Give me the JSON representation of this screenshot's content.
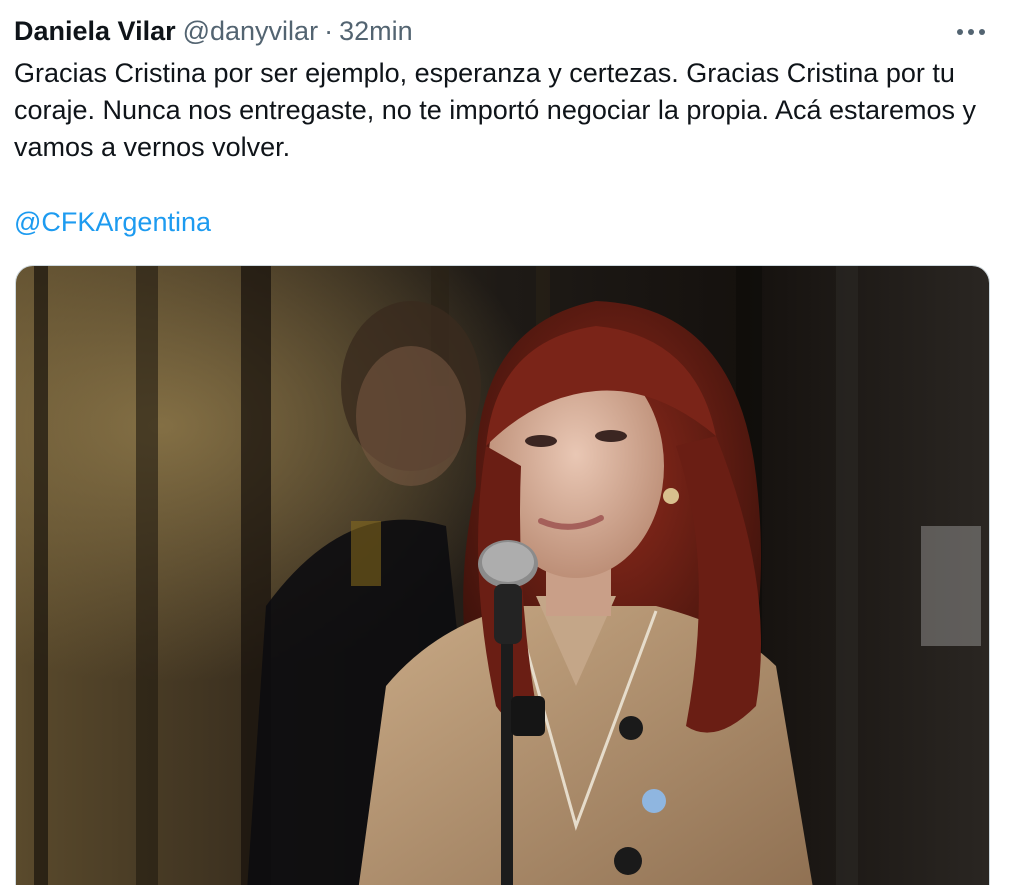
{
  "tweet": {
    "author_name": "Daniela Vilar",
    "author_handle": "@danyvilar",
    "separator": "·",
    "timestamp": "32min",
    "more_icon": "more-horizontal-icon",
    "text": "Gracias Cristina por ser ejemplo, esperanza y certezas. Gracias Cristina por tu coraje. Nunca nos entregaste, no te importó negociar la propia. Acá estaremos y vamos a vernos volver.",
    "mention": "@CFKArgentina",
    "mention_color": "#1d9bf0",
    "secondary_text_color": "#536471"
  }
}
